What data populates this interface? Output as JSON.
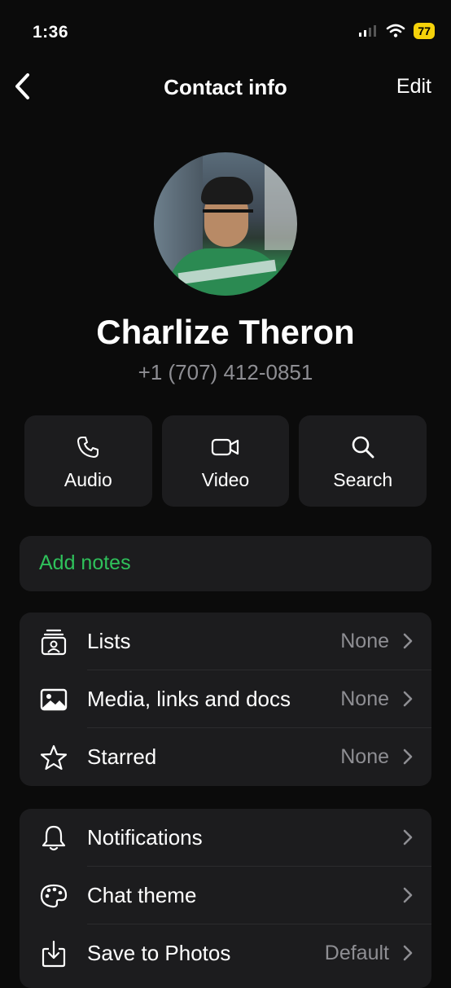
{
  "status": {
    "time": "1:36",
    "battery": "77"
  },
  "nav": {
    "title": "Contact info",
    "edit": "Edit"
  },
  "contact": {
    "name": "Charlize Theron",
    "phone": "+1 (707) 412-0851"
  },
  "actions": [
    {
      "label": "Audio",
      "icon": "phone-icon"
    },
    {
      "label": "Video",
      "icon": "video-icon"
    },
    {
      "label": "Search",
      "icon": "search-icon"
    }
  ],
  "notes": {
    "label": "Add notes",
    "color": "#2fc15b"
  },
  "group1": [
    {
      "label": "Lists",
      "value": "None",
      "icon": "lists-icon"
    },
    {
      "label": "Media, links and docs",
      "value": "None",
      "icon": "image-icon"
    },
    {
      "label": "Starred",
      "value": "None",
      "icon": "star-icon"
    }
  ],
  "group2": [
    {
      "label": "Notifications",
      "value": "",
      "icon": "bell-icon"
    },
    {
      "label": "Chat theme",
      "value": "",
      "icon": "palette-icon"
    },
    {
      "label": "Save to Photos",
      "value": "Default",
      "icon": "save-photos-icon"
    }
  ],
  "colors": {
    "background": "#0b0b0b",
    "card": "#1c1c1e",
    "secondary_text": "#8e8e93",
    "accent": "#2fc15b",
    "battery": "#f5d20a"
  }
}
